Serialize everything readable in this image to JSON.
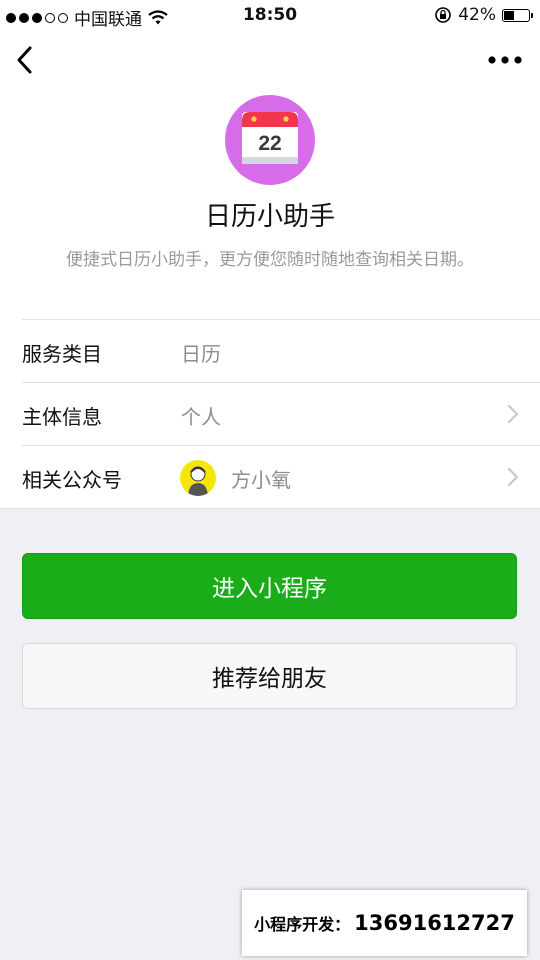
{
  "status_bar": {
    "carrier": "中国联通",
    "time": "18:50",
    "battery_percent": "42%",
    "battery_level": 0.42,
    "signal_bars_filled": 3,
    "signal_bars_total": 5
  },
  "nav": {
    "back_icon": "chevron-left-icon",
    "more_icon": "more-dots-icon"
  },
  "app": {
    "name": "日历小助手",
    "description": "便捷式日历小助手，更方便您随时随地查询相关日期。",
    "logo_day": "22",
    "logo_bg_color": "#d66ce7"
  },
  "info": {
    "service_category": {
      "label": "服务类目",
      "value": "日历"
    },
    "entity": {
      "label": "主体信息",
      "value": "个人"
    },
    "official_account": {
      "label": "相关公众号",
      "value": "方小氧"
    }
  },
  "actions": {
    "enter_label": "进入小程序",
    "share_label": "推荐给朋友",
    "accent_color": "#1aad19"
  },
  "promo": {
    "prefix": "小程序开发：",
    "phone": "13691612727"
  }
}
